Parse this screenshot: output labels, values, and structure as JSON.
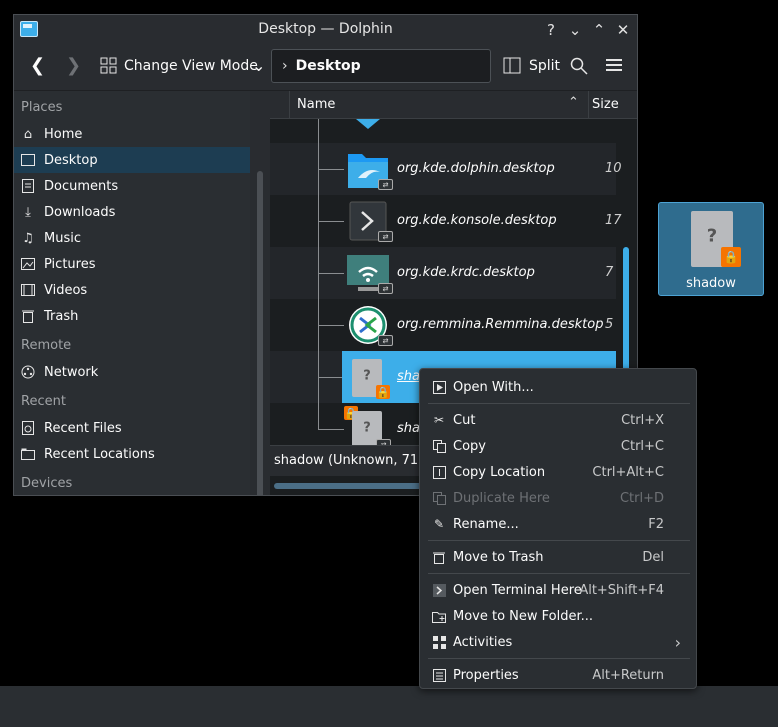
{
  "window": {
    "title": "Desktop — Dolphin",
    "buttons": {
      "help": "?",
      "minimize": "⌄",
      "maximize": "⌃",
      "close": "✕"
    }
  },
  "toolbar": {
    "back": "❮",
    "forward": "❯",
    "view_mode_label": "Change View Mode",
    "view_mode_arrow": "⌄",
    "location_crumb": "Desktop",
    "split_label": "Split"
  },
  "places": {
    "sections": [
      {
        "title": "Places",
        "items": [
          {
            "label": "Home",
            "icon": "home-icon"
          },
          {
            "label": "Desktop",
            "icon": "desktop-icon",
            "selected": true
          },
          {
            "label": "Documents",
            "icon": "documents-icon"
          },
          {
            "label": "Downloads",
            "icon": "downloads-icon"
          },
          {
            "label": "Music",
            "icon": "music-icon"
          },
          {
            "label": "Pictures",
            "icon": "pictures-icon"
          },
          {
            "label": "Videos",
            "icon": "videos-icon"
          },
          {
            "label": "Trash",
            "icon": "trash-icon"
          }
        ]
      },
      {
        "title": "Remote",
        "items": [
          {
            "label": "Network",
            "icon": "network-icon"
          }
        ]
      },
      {
        "title": "Recent",
        "items": [
          {
            "label": "Recent Files",
            "icon": "recent-files-icon"
          },
          {
            "label": "Recent Locations",
            "icon": "recent-locations-icon"
          }
        ]
      },
      {
        "title": "Devices",
        "items": []
      }
    ]
  },
  "file_view": {
    "columns": {
      "name": "Name",
      "size": "Size"
    },
    "rows": [
      {
        "name": "org.kde.dolphin.desktop",
        "size": "10",
        "icon": "dolphin-icon"
      },
      {
        "name": "org.kde.konsole.desktop",
        "size": "17",
        "icon": "konsole-icon"
      },
      {
        "name": "org.kde.krdc.desktop",
        "size": "7",
        "icon": "krdc-icon"
      },
      {
        "name": "org.remmina.Remmina.desktop",
        "size": "5",
        "icon": "remmina-icon"
      },
      {
        "name": "shadow",
        "size": "",
        "icon": "unknown-file-icon",
        "selected": true
      },
      {
        "name": "sha",
        "size": "",
        "icon": "unknown-file-icon"
      }
    ],
    "status": "shadow (Unknown, 715"
  },
  "desktop_icon": {
    "label": "shadow"
  },
  "context_menu": {
    "items": [
      {
        "label": "Open With...",
        "shortcut": "",
        "icon": "open-with-icon"
      },
      {
        "label": "Cut",
        "shortcut": "Ctrl+X",
        "icon": "cut-icon"
      },
      {
        "label": "Copy",
        "shortcut": "Ctrl+C",
        "icon": "copy-icon"
      },
      {
        "label": "Copy Location",
        "shortcut": "Ctrl+Alt+C",
        "icon": "copy-location-icon"
      },
      {
        "label": "Duplicate Here",
        "shortcut": "Ctrl+D",
        "icon": "duplicate-icon",
        "disabled": true
      },
      {
        "label": "Rename...",
        "shortcut": "F2",
        "icon": "rename-icon"
      },
      {
        "label": "Move to Trash",
        "shortcut": "Del",
        "icon": "trash-icon"
      },
      {
        "label": "Open Terminal Here",
        "shortcut": "Alt+Shift+F4",
        "icon": "terminal-icon"
      },
      {
        "label": "Move to New Folder...",
        "shortcut": "",
        "icon": "new-folder-icon"
      },
      {
        "label": "Activities",
        "shortcut": "",
        "icon": "activities-icon",
        "submenu_arrow": "›"
      },
      {
        "label": "Properties",
        "shortcut": "Alt+Return",
        "icon": "properties-icon"
      }
    ]
  }
}
